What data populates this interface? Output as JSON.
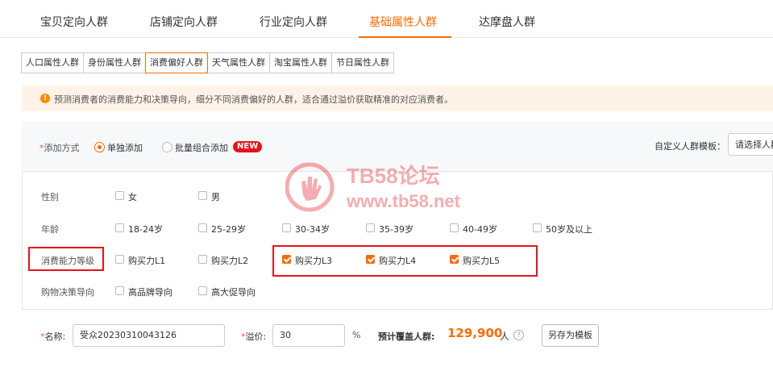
{
  "top_tabs": [
    {
      "label": "宝贝定向人群"
    },
    {
      "label": "店铺定向人群"
    },
    {
      "label": "行业定向人群"
    },
    {
      "label": "基础属性人群",
      "active": true
    },
    {
      "label": "达摩盘人群"
    }
  ],
  "sub_tabs": [
    {
      "label": "人口属性人群"
    },
    {
      "label": "身份属性人群"
    },
    {
      "label": "消费偏好人群",
      "active": true
    },
    {
      "label": "天气属性人群"
    },
    {
      "label": "淘宝属性人群"
    },
    {
      "label": "节日属性人群"
    }
  ],
  "notice": {
    "text": "预测消费者的消费能力和决策导向，细分不同消费偏好的人群，适合通过溢价获取精准的对应消费者。"
  },
  "add_method": {
    "required_mark": "*",
    "label": "添加方式",
    "option_single": "单独添加",
    "option_batch": "批量组合添加",
    "new_badge": "NEW",
    "template_label": "自定义人群模板：",
    "template_select": "请选择人群"
  },
  "attributes": {
    "gender": {
      "label": "性别",
      "options": [
        {
          "label": "女",
          "checked": false
        },
        {
          "label": "男",
          "checked": false
        }
      ]
    },
    "age": {
      "label": "年龄",
      "options": [
        {
          "label": "18-24岁",
          "checked": false
        },
        {
          "label": "25-29岁",
          "checked": false
        },
        {
          "label": "30-34岁",
          "checked": false
        },
        {
          "label": "35-39岁",
          "checked": false
        },
        {
          "label": "40-49岁",
          "checked": false
        },
        {
          "label": "50岁及以上",
          "checked": false
        }
      ]
    },
    "consumption_level": {
      "label": "消费能力等级",
      "options": [
        {
          "label": "购买力L1",
          "checked": false
        },
        {
          "label": "购买力L2",
          "checked": false
        },
        {
          "label": "购买力L3",
          "checked": true
        },
        {
          "label": "购买力L4",
          "checked": true
        },
        {
          "label": "购买力L5",
          "checked": true
        }
      ]
    },
    "shopping_decision": {
      "label": "购物决策导向",
      "options": [
        {
          "label": "高品牌导向",
          "checked": false
        },
        {
          "label": "高大促导向",
          "checked": false
        }
      ]
    }
  },
  "footer": {
    "required_mark": "*",
    "name_label": "名称:",
    "name_value": "受众20230310043126",
    "premium_label": "溢价:",
    "premium_value": "30",
    "percent": "%",
    "coverage_label": "预计覆盖人群:",
    "coverage_value": "129,900",
    "coverage_unit": "人",
    "help_icon": "?",
    "save_template_button": "另存为模板"
  },
  "watermark": {
    "text1": "TB58论坛",
    "text2": "www.tb58.net"
  },
  "colors": {
    "accent": "#ff6a00",
    "highlight_red": "#e8131a",
    "notice_bg": "#fff3e8"
  }
}
